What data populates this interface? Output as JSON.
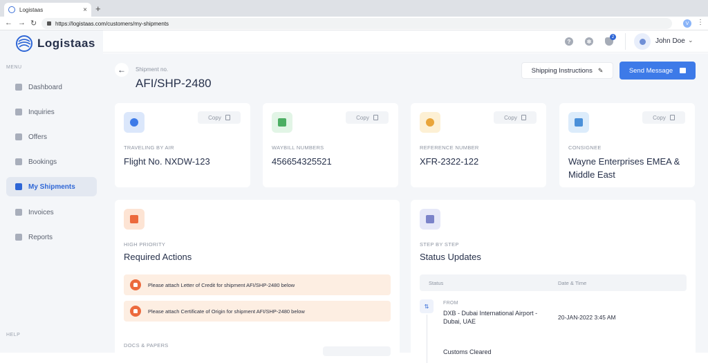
{
  "browser": {
    "tab_title": "Logistaas",
    "url": "https://logistaas.com/customers/my-shipments",
    "profile_initial": "V"
  },
  "sidebar": {
    "brand": "Logistaas",
    "menu_heading": "MENU",
    "help_heading": "HELP",
    "items": [
      {
        "label": "Dashboard",
        "icon": "dashboard-icon"
      },
      {
        "label": "Inquiries",
        "icon": "chat-icon"
      },
      {
        "label": "Offers",
        "icon": "clipboard-icon"
      },
      {
        "label": "Bookings",
        "icon": "ship-icon"
      },
      {
        "label": "My Shipments",
        "icon": "truck-icon",
        "active": true
      },
      {
        "label": "Invoices",
        "icon": "invoice-icon"
      },
      {
        "label": "Reports",
        "icon": "pie-chart-icon"
      }
    ]
  },
  "header": {
    "notification_count": "2",
    "user_name": "John Doe"
  },
  "page": {
    "shipment_label": "Shipment no.",
    "shipment_number": "AFI/SHP-2480",
    "shipping_instructions_label": "Shipping Instructions",
    "send_message_label": "Send Message"
  },
  "info_cards": [
    {
      "label": "TRAVELING BY AIR",
      "value": "Flight No. NXDW-123",
      "copy": "Copy",
      "icon": "globe-icon",
      "color": "#dbe7fb",
      "dot": "#3d7ae8"
    },
    {
      "label": "WAYBILL NUMBERS",
      "value": "456654325521",
      "copy": "Copy",
      "icon": "barcode-icon",
      "color": "#e2f5e6",
      "dot": "#4cae63"
    },
    {
      "label": "REFERENCE NUMBER",
      "value": "XFR-2322-122",
      "copy": "Copy",
      "icon": "target-icon",
      "color": "#fdf0d4",
      "dot": "#e9a53a"
    },
    {
      "label": "CONSIGNEE",
      "value": "Wayne Enterprises EMEA & Middle East",
      "copy": "Copy",
      "icon": "document-icon",
      "color": "#dcecfb",
      "dot": "#4a90d9"
    }
  ],
  "actions": {
    "subtitle": "HIGH PRIORITY",
    "title": "Required Actions",
    "alerts": [
      "Please attach Letter of Credit for shipment AFI/SHP-2480 below",
      "Please attach Certificate of Origin for shipment AFI/SHP-2480 below"
    ],
    "docs_label": "DOCS & PAPERS"
  },
  "status": {
    "subtitle": "STEP BY STEP",
    "title": "Status Updates",
    "col_status": "Status",
    "col_date": "Date & Time",
    "rows": [
      {
        "label": "FROM",
        "place": "DXB - Dubai International Airport - Dubai, UAE",
        "date": "20-JAN-2022 3:45 AM"
      }
    ],
    "next_status": "Customs Cleared"
  },
  "colors": {
    "accent": "#3d7ae8",
    "alert_bg": "#fdeee2",
    "alert_icon": "#ec6a3d"
  }
}
